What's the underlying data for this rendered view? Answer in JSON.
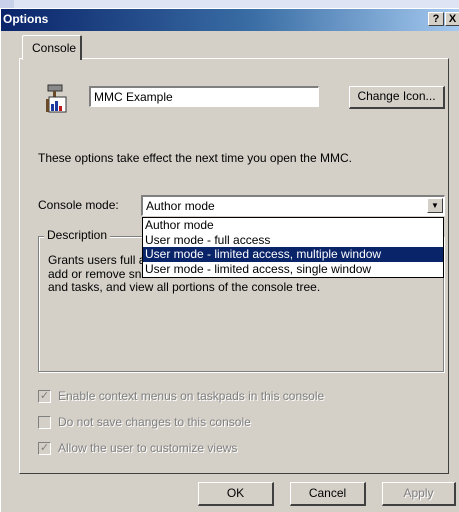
{
  "window": {
    "title": "Options",
    "help_glyph": "?",
    "close_glyph": "X"
  },
  "tabs": [
    {
      "label": "Console"
    }
  ],
  "console": {
    "name_value": "MMC Example",
    "change_icon_label": "Change Icon...",
    "info_text": "These options take effect the next time you open the MMC.",
    "mode_label": "Console mode:",
    "mode_value": "Author mode",
    "mode_options": [
      "Author mode",
      "User mode - full access",
      "User mode - limited access, multiple window",
      "User mode - limited access, single window"
    ],
    "highlighted_option_index": 2,
    "description_title": "Description",
    "description_line1": "Grants users full a",
    "description_line2": "add or remove sna",
    "description_line3": "and tasks, and view all portions of the console tree."
  },
  "options": [
    {
      "label": "Enable context menus on taskpads in this console",
      "checked": true
    },
    {
      "label": "Do not save changes to this console",
      "checked": false
    },
    {
      "label": "Allow the user to customize views",
      "checked": true
    }
  ],
  "buttons": {
    "ok": "OK",
    "cancel": "Cancel",
    "apply": "Apply"
  },
  "icons": {
    "console_icon": "hammer-chart-icon",
    "dropdown_arrow": "chevron-down-icon"
  }
}
